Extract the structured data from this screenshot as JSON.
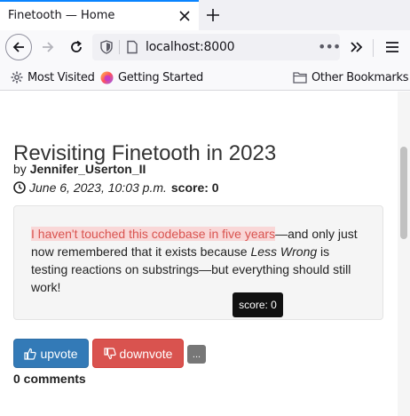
{
  "browser": {
    "tab_title": "Finetooth — Home",
    "url": "localhost:8000",
    "url_menu": "•••",
    "bookmarks": [
      {
        "label": "Most Visited",
        "icon": "gear-icon"
      },
      {
        "label": "Getting Started",
        "icon": "firefox-icon"
      }
    ],
    "other_bookmarks": "Other Bookmarks"
  },
  "post": {
    "title": "Revisiting Finetooth in 2023",
    "by_label": "by",
    "author": "Jennifer_Userton_II",
    "date": "June 6, 2023, 10:03 p.m.",
    "score_label": "score: 0",
    "body": {
      "highlighted": "I haven't touched this codebase in five years",
      "part1": "—and only just now remembered that it exists because ",
      "italic": "Less Wrong",
      "part2": " is testing reactions on substrings—but everything should still work!"
    },
    "tooltip": "score: 0",
    "upvote_label": "upvote",
    "downvote_label": "downvote",
    "more_label": "...",
    "comments_label": "0 comments"
  },
  "colors": {
    "highlight_bg": "#f9d7d7",
    "highlight_text": "#d9534f",
    "upvote_bg": "#337ab7",
    "downvote_bg": "#d9534f",
    "tab_accent": "#0a84ff"
  }
}
